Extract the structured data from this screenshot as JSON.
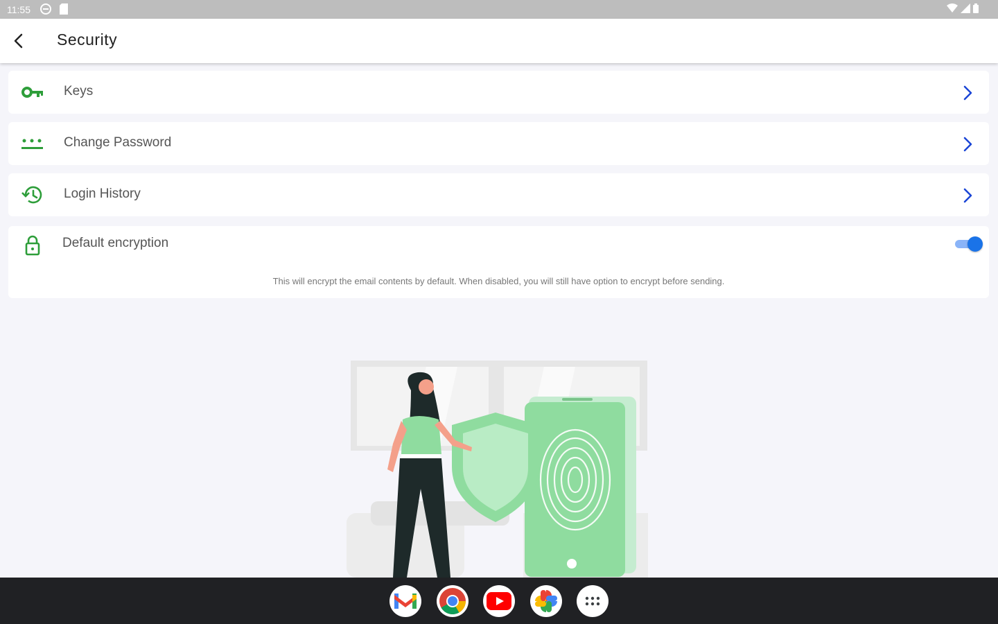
{
  "status_bar": {
    "time": "11:55"
  },
  "header": {
    "title": "Security"
  },
  "menu": {
    "keys": "Keys",
    "change_password": "Change Password",
    "login_history": "Login History"
  },
  "encryption": {
    "label": "Default encryption",
    "enabled": true,
    "description": "This will encrypt the email contents by default. When disabled, you will still have option to encrypt before sending."
  },
  "taskbar": {
    "apps": [
      "gmail-icon",
      "chrome-icon",
      "youtube-icon",
      "photos-icon",
      "app-launcher-icon"
    ]
  },
  "colors": {
    "accent_green": "#2e9e3a",
    "chevron_blue": "#1a45d6",
    "toggle_blue": "#1a73e8"
  }
}
